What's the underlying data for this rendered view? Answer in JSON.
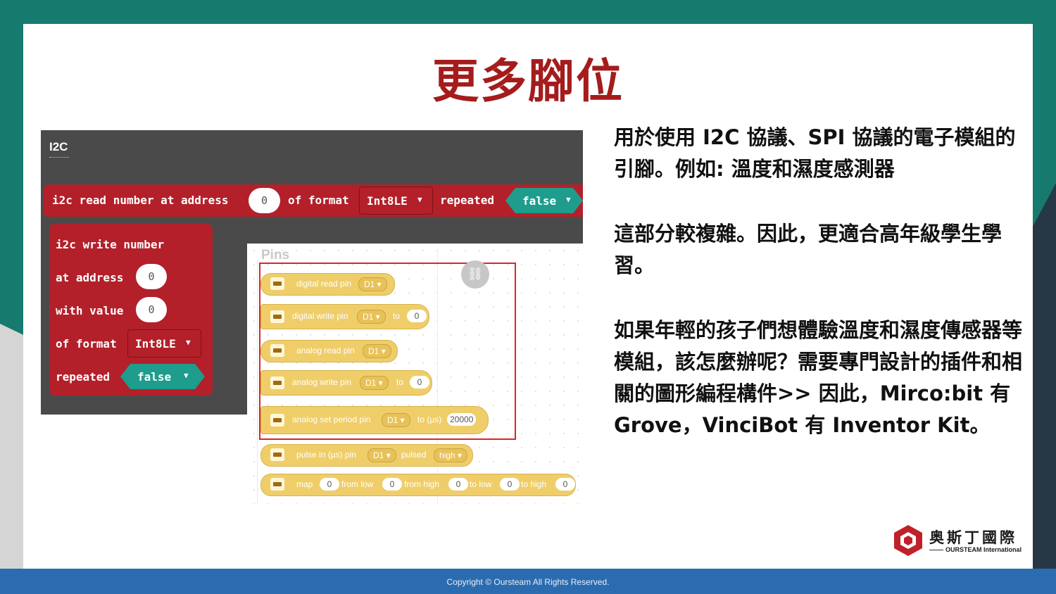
{
  "slide": {
    "title": "更多腳位",
    "footer": "Copyright © Oursteam All Rights Reserved.",
    "paragraphs": [
      "用於使用 I2C 協議、SPI 協議的電子模組的引腳。例如: 溫度和濕度感測器",
      "這部分較複雜。因此，更適合高年級學生學習。",
      "如果年輕的孩子們想體驗溫度和濕度傳感器等模組，該怎麼辦呢？需要專門設計的插件和相關的圖形編程構件>> 因此，Mirco:bit 有 Grove，VinciBot 有 Inventor Kit。"
    ],
    "logo": {
      "chinese": "奥斯丁國際",
      "english": "OURSTEAM International"
    },
    "colors": {
      "title": "#a51c1c",
      "block_red": "#b3202a",
      "teal": "#1e9c8c",
      "pin_yellow": "#efce6a",
      "footer_blue": "#2b6cb0"
    }
  },
  "i2c": {
    "header": "I2C",
    "read_block": {
      "prefix": "i2c read number at address",
      "address": "0",
      "of_format": "of format",
      "format": "Int8LE",
      "repeated": "repeated",
      "repeated_value": "false"
    },
    "write_block": {
      "title": "i2c write number",
      "at_address": "at address",
      "address": "0",
      "with_value": "with value",
      "value": "0",
      "of_format": "of format",
      "format": "Int8LE",
      "repeated": "repeated",
      "repeated_value": "false"
    }
  },
  "pins": {
    "title": "Pins",
    "blocks": [
      {
        "label": "digital read pin",
        "pin": "D1"
      },
      {
        "label": "digital write pin",
        "pin": "D1",
        "to": "to",
        "value": "0"
      },
      {
        "label": "analog read pin",
        "pin": "D1"
      },
      {
        "label": "analog write pin",
        "pin": "D1",
        "to": "to",
        "value": "0"
      },
      {
        "label": "analog set period pin",
        "pin": "D1",
        "to": "to (µs)",
        "value": "20000"
      },
      {
        "label": "pulse in (µs) pin",
        "pin": "D1",
        "pulsed": "pulsed",
        "level": "high"
      },
      {
        "map": "map",
        "v1": "0",
        "from_low": "from low",
        "v2": "0",
        "from_high": "from high",
        "v3": "0",
        "to_low": "to low",
        "v4": "0",
        "to_high": "to high",
        "v5": "0"
      }
    ]
  }
}
